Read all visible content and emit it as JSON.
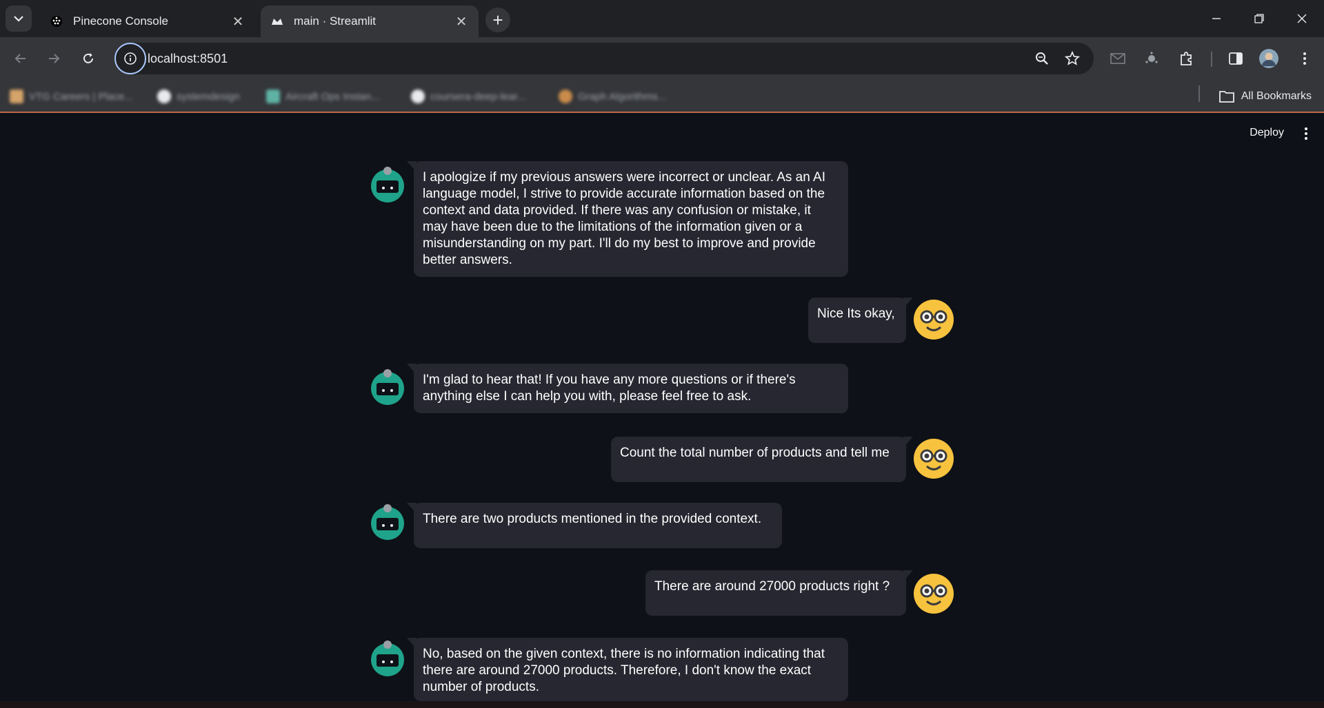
{
  "browser": {
    "tabs": [
      {
        "title": "Pinecone Console",
        "active": false
      },
      {
        "title": "main · Streamlit",
        "active": true
      }
    ],
    "url": "localhost:8501",
    "bookmarks": [
      {
        "label": "VTG Careers | Place..."
      },
      {
        "label": "systemdesign"
      },
      {
        "label": "Aircraft Ops Instan..."
      },
      {
        "label": "coursera-deep-lear..."
      },
      {
        "label": "Graph Algorithms..."
      }
    ],
    "all_bookmarks_label": "All Bookmarks"
  },
  "app": {
    "deploy_label": "Deploy",
    "messages": [
      {
        "role": "assistant",
        "text": "I apologize if my previous answers were incorrect or unclear. As an AI language model, I strive to provide accurate information based on the context and data provided. If there was any confusion or mistake, it may have been due to the limitations of the information given or a misunderstanding on my part. I'll do my best to improve and provide better answers."
      },
      {
        "role": "user",
        "text": "Nice Its okay,"
      },
      {
        "role": "assistant",
        "text": "I'm glad to hear that! If you have any more questions or if there's anything else I can help you with, please feel free to ask."
      },
      {
        "role": "user",
        "text": "Count the total number of products and tell me"
      },
      {
        "role": "assistant",
        "text": "There are two products mentioned in the provided context."
      },
      {
        "role": "user",
        "text": "There are around 27000 products right ?"
      },
      {
        "role": "assistant",
        "text": "No, based on the given context, there is no information indicating that there are around 27000 products. Therefore, I don't know the exact number of products."
      }
    ]
  },
  "colors": {
    "page_bg": "#0e1117",
    "bubble_bg": "#262730",
    "bot_avatar": "#1fa38a",
    "user_avatar": "#f7c23e"
  }
}
